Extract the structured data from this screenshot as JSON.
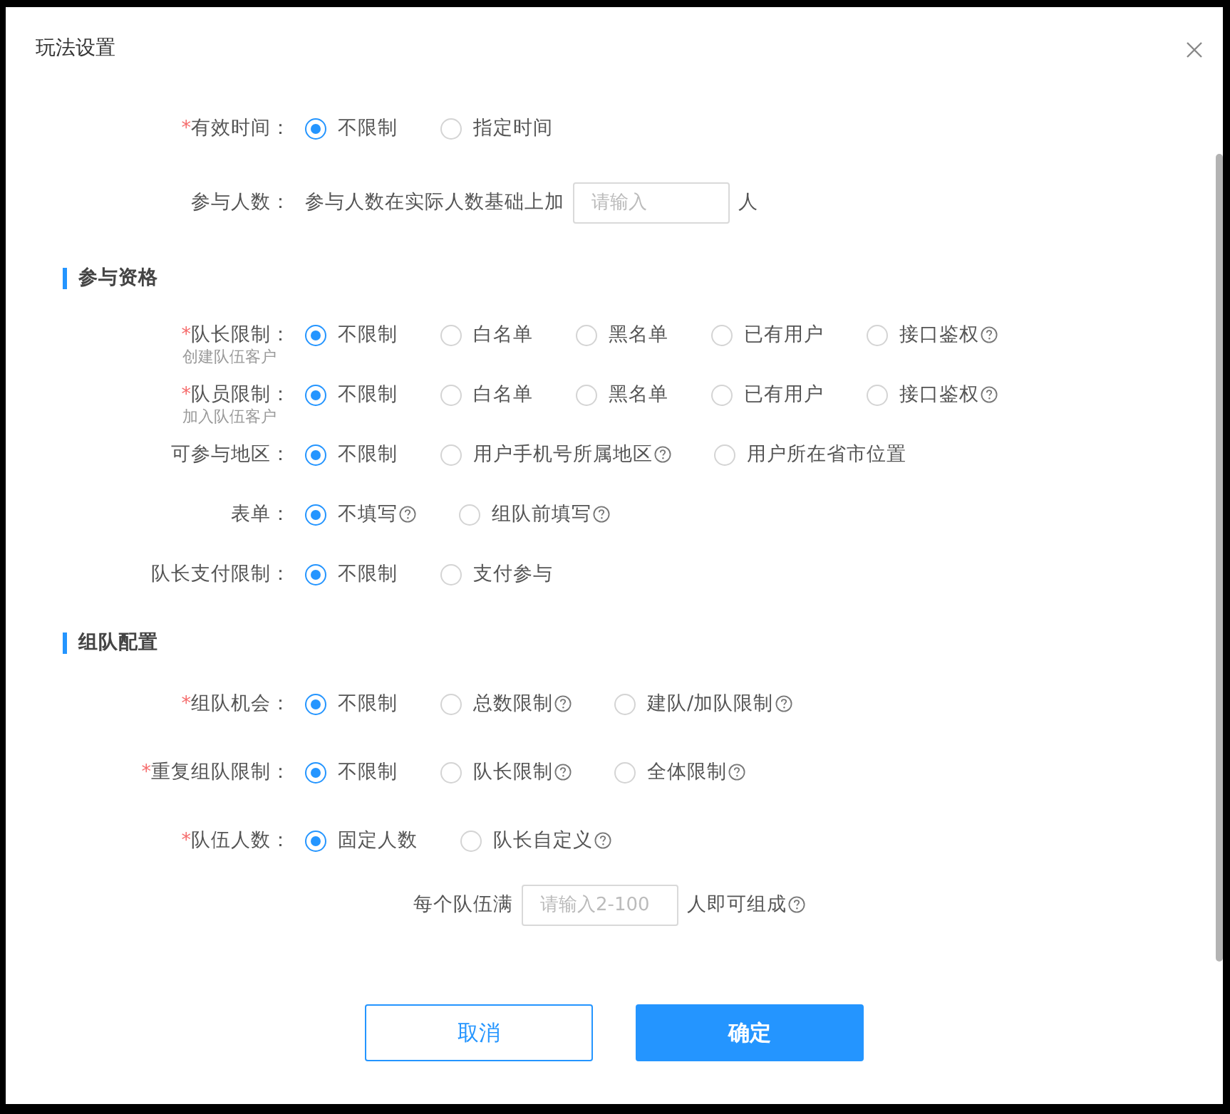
{
  "dialog": {
    "title": "玩法设置"
  },
  "groups": [
    {
      "fields": [
        {
          "kind": "radio",
          "label": "有效时间：",
          "required_mark": "*",
          "options": [
            {
              "label": "不限制",
              "selected": true,
              "help": false
            },
            {
              "label": "指定时间",
              "selected": false,
              "help": false
            }
          ]
        },
        {
          "kind": "input",
          "label": "参与人数：",
          "prefix": "参与人数在实际人数基础上加",
          "placeholder": "请输入",
          "suffix": "人"
        }
      ]
    },
    {
      "heading": "参与资格",
      "fields": [
        {
          "kind": "radio",
          "label": "队长限制：",
          "required_mark": "*",
          "sublabel": "创建队伍客户",
          "options": [
            {
              "label": "不限制",
              "selected": true,
              "help": false
            },
            {
              "label": "白名单",
              "selected": false,
              "help": false
            },
            {
              "label": "黑名单",
              "selected": false,
              "help": false
            },
            {
              "label": "已有用户",
              "selected": false,
              "help": false
            },
            {
              "label": "接口鉴权",
              "selected": false,
              "help": true
            }
          ]
        },
        {
          "kind": "radio",
          "label": "队员限制：",
          "required_mark": "*",
          "sublabel": "加入队伍客户",
          "options": [
            {
              "label": "不限制",
              "selected": true,
              "help": false
            },
            {
              "label": "白名单",
              "selected": false,
              "help": false
            },
            {
              "label": "黑名单",
              "selected": false,
              "help": false
            },
            {
              "label": "已有用户",
              "selected": false,
              "help": false
            },
            {
              "label": "接口鉴权",
              "selected": false,
              "help": true
            }
          ]
        },
        {
          "kind": "radio",
          "label": "可参与地区：",
          "options": [
            {
              "label": "不限制",
              "selected": true,
              "help": false
            },
            {
              "label": "用户手机号所属地区",
              "selected": false,
              "help": true
            },
            {
              "label": "用户所在省市位置",
              "selected": false,
              "help": false
            }
          ]
        },
        {
          "kind": "radio",
          "label": "表单：",
          "options": [
            {
              "label": "不填写",
              "selected": true,
              "help": true
            },
            {
              "label": "组队前填写",
              "selected": false,
              "help": true
            }
          ]
        },
        {
          "kind": "radio",
          "label": "队长支付限制：",
          "options": [
            {
              "label": "不限制",
              "selected": true,
              "help": false
            },
            {
              "label": "支付参与",
              "selected": false,
              "help": false
            }
          ]
        }
      ]
    },
    {
      "heading": "组队配置",
      "fields": [
        {
          "kind": "radio",
          "label": "组队机会：",
          "required_mark": "*",
          "options": [
            {
              "label": "不限制",
              "selected": true,
              "help": false
            },
            {
              "label": "总数限制",
              "selected": false,
              "help": true
            },
            {
              "label": "建队/加队限制",
              "selected": false,
              "help": true
            }
          ]
        },
        {
          "kind": "radio",
          "label": "重复组队限制：",
          "required_mark": "*",
          "options": [
            {
              "label": "不限制",
              "selected": true,
              "help": false
            },
            {
              "label": "队长限制",
              "selected": false,
              "help": true
            },
            {
              "label": "全体限制",
              "selected": false,
              "help": true
            }
          ]
        },
        {
          "kind": "radio",
          "label": "队伍人数：",
          "required_mark": "*",
          "options": [
            {
              "label": "固定人数",
              "selected": true,
              "help": false
            },
            {
              "label": "队长自定义",
              "selected": false,
              "help": true
            }
          ]
        },
        {
          "kind": "input",
          "prefix": "每个队伍满",
          "placeholder": "请输入2-100",
          "suffix": "人即可组成",
          "help": true
        }
      ]
    }
  ],
  "buttons": [
    {
      "label": "取消",
      "kind": "secondary"
    },
    {
      "label": "确定",
      "kind": "primary"
    }
  ]
}
